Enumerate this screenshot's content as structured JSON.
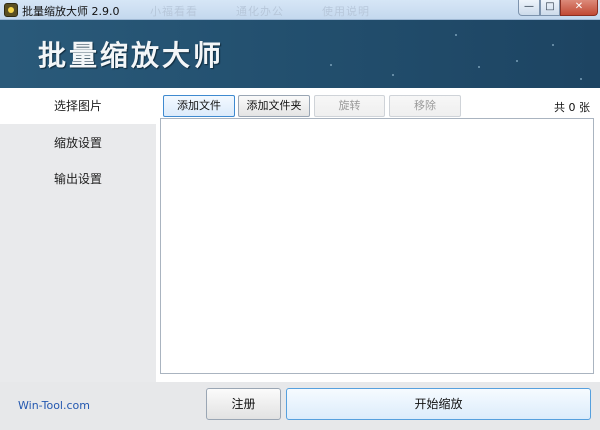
{
  "window": {
    "title": "批量缩放大师 2.9.0",
    "ghost_menu": [
      "小福看看",
      "通化办公",
      "使用说明"
    ],
    "min_label": "—",
    "max_label": "□",
    "close_label": "✕"
  },
  "banner": {
    "title": "批量缩放大师"
  },
  "sidebar": {
    "items": [
      {
        "label": "选择图片"
      },
      {
        "label": "缩放设置"
      },
      {
        "label": "输出设置"
      }
    ]
  },
  "toolbar": {
    "add_file": "添加文件",
    "add_folder": "添加文件夹",
    "rotate": "旋转",
    "remove": "移除",
    "count": "共 0 张"
  },
  "footer": {
    "site": "Win-Tool.com",
    "register": "注册",
    "start": "开始缩放"
  },
  "colors": {
    "banner": "#23506f",
    "sidebar": "#e9eaec",
    "link": "#2458b0"
  }
}
